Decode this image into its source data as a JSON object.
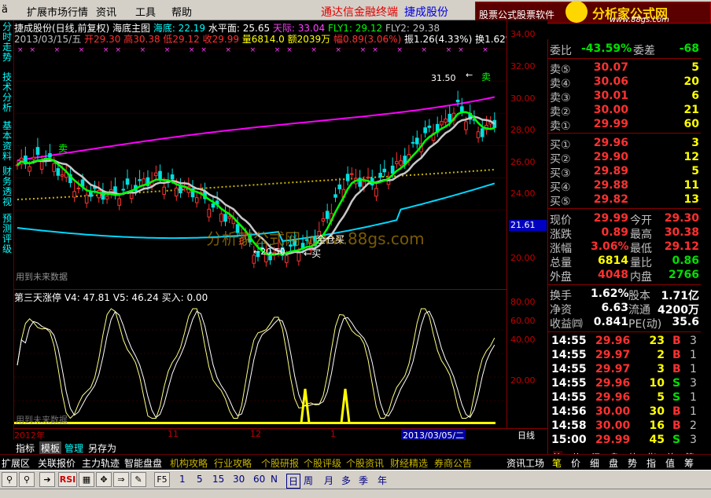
{
  "menu": {
    "items": [
      "扩展市场行情",
      "资讯",
      "工具",
      "帮助"
    ],
    "brand1": "通达信金融终端",
    "brand2": "捷成股份",
    "ad_text": "股票公式股票软件",
    "ad_logo": "分析家公式网",
    "ad_url": "www.88gs.com"
  },
  "left_tabs": [
    "分时走势",
    "技术分析",
    "基本资料",
    "财务透视",
    "预测评级"
  ],
  "main_header": {
    "title": "捷成股份(日线,前复权) 海底主图",
    "hd_label": "海底: 22.19",
    "sp_label": "水平面: 25.65",
    "tj_label": "天际: 33.04",
    "fly1": "FLY1: 29.12",
    "fly2": "FLY2: 29.38"
  },
  "ohlc": {
    "date": "2013/03/15/五",
    "open": "开29.30",
    "high": "高30.38",
    "low": "低29.12",
    "close": "收29.99",
    "vol": "量6814.0",
    "amt": "额2039万",
    "chg": "幅0.89(3.06%)",
    "amp": "振1.26(4.33%)",
    "turn": "换1.62%",
    "flow": "流"
  },
  "annotations": {
    "sell1": "卖",
    "sell2": "卖",
    "buy1": "买",
    "buy2": "全仓买",
    "low_price": "←20.50",
    "high_price": "31.50",
    "arrow": "←",
    "future": "用到未来数据",
    "future2": "用到未来数据",
    "watermark": "分析家公式网 www.88gs.com"
  },
  "price_axis": {
    "labels": [
      "34.00",
      "32.00",
      "30.00",
      "28.00",
      "26.00",
      "24.00",
      "22.00",
      "20.00"
    ],
    "current": "21.61"
  },
  "sub_header": {
    "title": "第三天涨停",
    "v4": "V4: 47.81",
    "v5": "V5: 46.24",
    "buy": "买入: 0.00"
  },
  "sub_axis": [
    "80.00",
    "60.00",
    "40.00",
    "20.00"
  ],
  "time_axis": {
    "labels": [
      "2012年",
      "11",
      "12",
      "1"
    ],
    "cursor": "2013/03/05/二",
    "period": "日线"
  },
  "bottom_tabs1": [
    "指标",
    "模板",
    "管理",
    "另存为"
  ],
  "bottom_tabs2": [
    "扩展区",
    "关联报价",
    "主力轨迹",
    "智能盘盘",
    "机构攻略",
    "行业攻略",
    "个股研报",
    "个股评级",
    "个股资讯",
    "财经精选",
    "券商公告",
    "资讯工场"
  ],
  "quote_tabs": [
    "笔",
    "价",
    "细",
    "盘",
    "势",
    "指",
    "值",
    "筹"
  ],
  "quote": {
    "wb_label": "委比",
    "wb": "-43.59%",
    "wc_label": "委差",
    "wc": "-68",
    "sells": [
      {
        "label": "卖⑤",
        "price": "30.07",
        "vol": "5"
      },
      {
        "label": "卖④",
        "price": "30.06",
        "vol": "20"
      },
      {
        "label": "卖③",
        "price": "30.01",
        "vol": "6"
      },
      {
        "label": "卖②",
        "price": "30.00",
        "vol": "21"
      },
      {
        "label": "卖①",
        "price": "29.99",
        "vol": "60"
      }
    ],
    "buys": [
      {
        "label": "买①",
        "price": "29.96",
        "vol": "3"
      },
      {
        "label": "买②",
        "price": "29.90",
        "vol": "12"
      },
      {
        "label": "买③",
        "price": "29.89",
        "vol": "5"
      },
      {
        "label": "买④",
        "price": "29.88",
        "vol": "11"
      },
      {
        "label": "买⑤",
        "price": "29.82",
        "vol": "13"
      }
    ],
    "stats": [
      {
        "l1": "现价",
        "v1": "29.99",
        "l2": "今开",
        "v2": "29.30"
      },
      {
        "l1": "涨跌",
        "v1": "0.89",
        "l2": "最高",
        "v2": "30.38"
      },
      {
        "l1": "涨幅",
        "v1": "3.06%",
        "l2": "最低",
        "v2": "29.12"
      },
      {
        "l1": "总量",
        "v1": "6814",
        "l2": "量比",
        "v2": "0.86"
      },
      {
        "l1": "外盘",
        "v1": "4048",
        "l2": "内盘",
        "v2": "2766"
      }
    ],
    "fin": [
      {
        "l1": "换手",
        "v1": "1.62%",
        "l2": "股本",
        "v2": "1.71亿"
      },
      {
        "l1": "净资",
        "v1": "6.63",
        "l2": "流通",
        "v2": "4200万"
      },
      {
        "l1": "收益㈣",
        "v1": "0.841",
        "l2": "PE(动)",
        "v2": "35.6"
      }
    ],
    "ticks": [
      {
        "t": "14:55",
        "p": "29.96",
        "v": "23",
        "d": "B",
        "n": "3"
      },
      {
        "t": "14:55",
        "p": "29.97",
        "v": "2",
        "d": "B",
        "n": "1"
      },
      {
        "t": "14:55",
        "p": "29.97",
        "v": "3",
        "d": "B",
        "n": "1"
      },
      {
        "t": "14:55",
        "p": "29.96",
        "v": "10",
        "d": "S",
        "n": "3"
      },
      {
        "t": "14:55",
        "p": "29.96",
        "v": "5",
        "d": "S",
        "n": "1"
      },
      {
        "t": "14:56",
        "p": "30.00",
        "v": "30",
        "d": "B",
        "n": "1"
      },
      {
        "t": "14:58",
        "p": "30.00",
        "v": "16",
        "d": "B",
        "n": "2"
      },
      {
        "t": "15:00",
        "p": "29.99",
        "v": "45",
        "d": "S",
        "n": "3"
      }
    ]
  },
  "toolbar": {
    "periods": [
      "1",
      "5",
      "15",
      "30",
      "60",
      "N",
      "日",
      "周",
      "月",
      "多",
      "季",
      "年"
    ],
    "rsi": "RSI",
    "f5": "F5"
  }
}
